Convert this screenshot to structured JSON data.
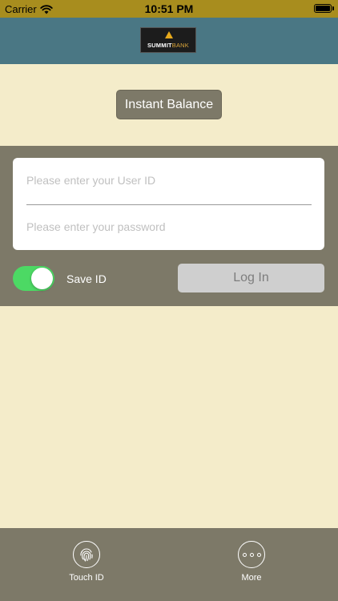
{
  "status_bar": {
    "carrier": "Carrier",
    "time": "10:51 PM"
  },
  "header": {
    "logo_text_bold": "SUMMIT",
    "logo_text_light": "BANK"
  },
  "instant_balance": {
    "label": "Instant Balance"
  },
  "login": {
    "user_id_placeholder": "Please enter your User ID",
    "user_id_value": "",
    "password_placeholder": "Please enter your password",
    "password_value": "",
    "save_id_label": "Save ID",
    "save_id_on": true,
    "login_label": "Log In"
  },
  "tab_bar": {
    "items": [
      {
        "label": "Touch ID",
        "icon": "fingerprint-icon"
      },
      {
        "label": "More",
        "icon": "more-dots-icon"
      }
    ]
  },
  "colors": {
    "status_bar": "#a88d1e",
    "header": "#4a7784",
    "background": "#f4ecca",
    "panel": "#7d7968",
    "toggle_on": "#4cd964",
    "login_button": "#cfcfcf"
  }
}
